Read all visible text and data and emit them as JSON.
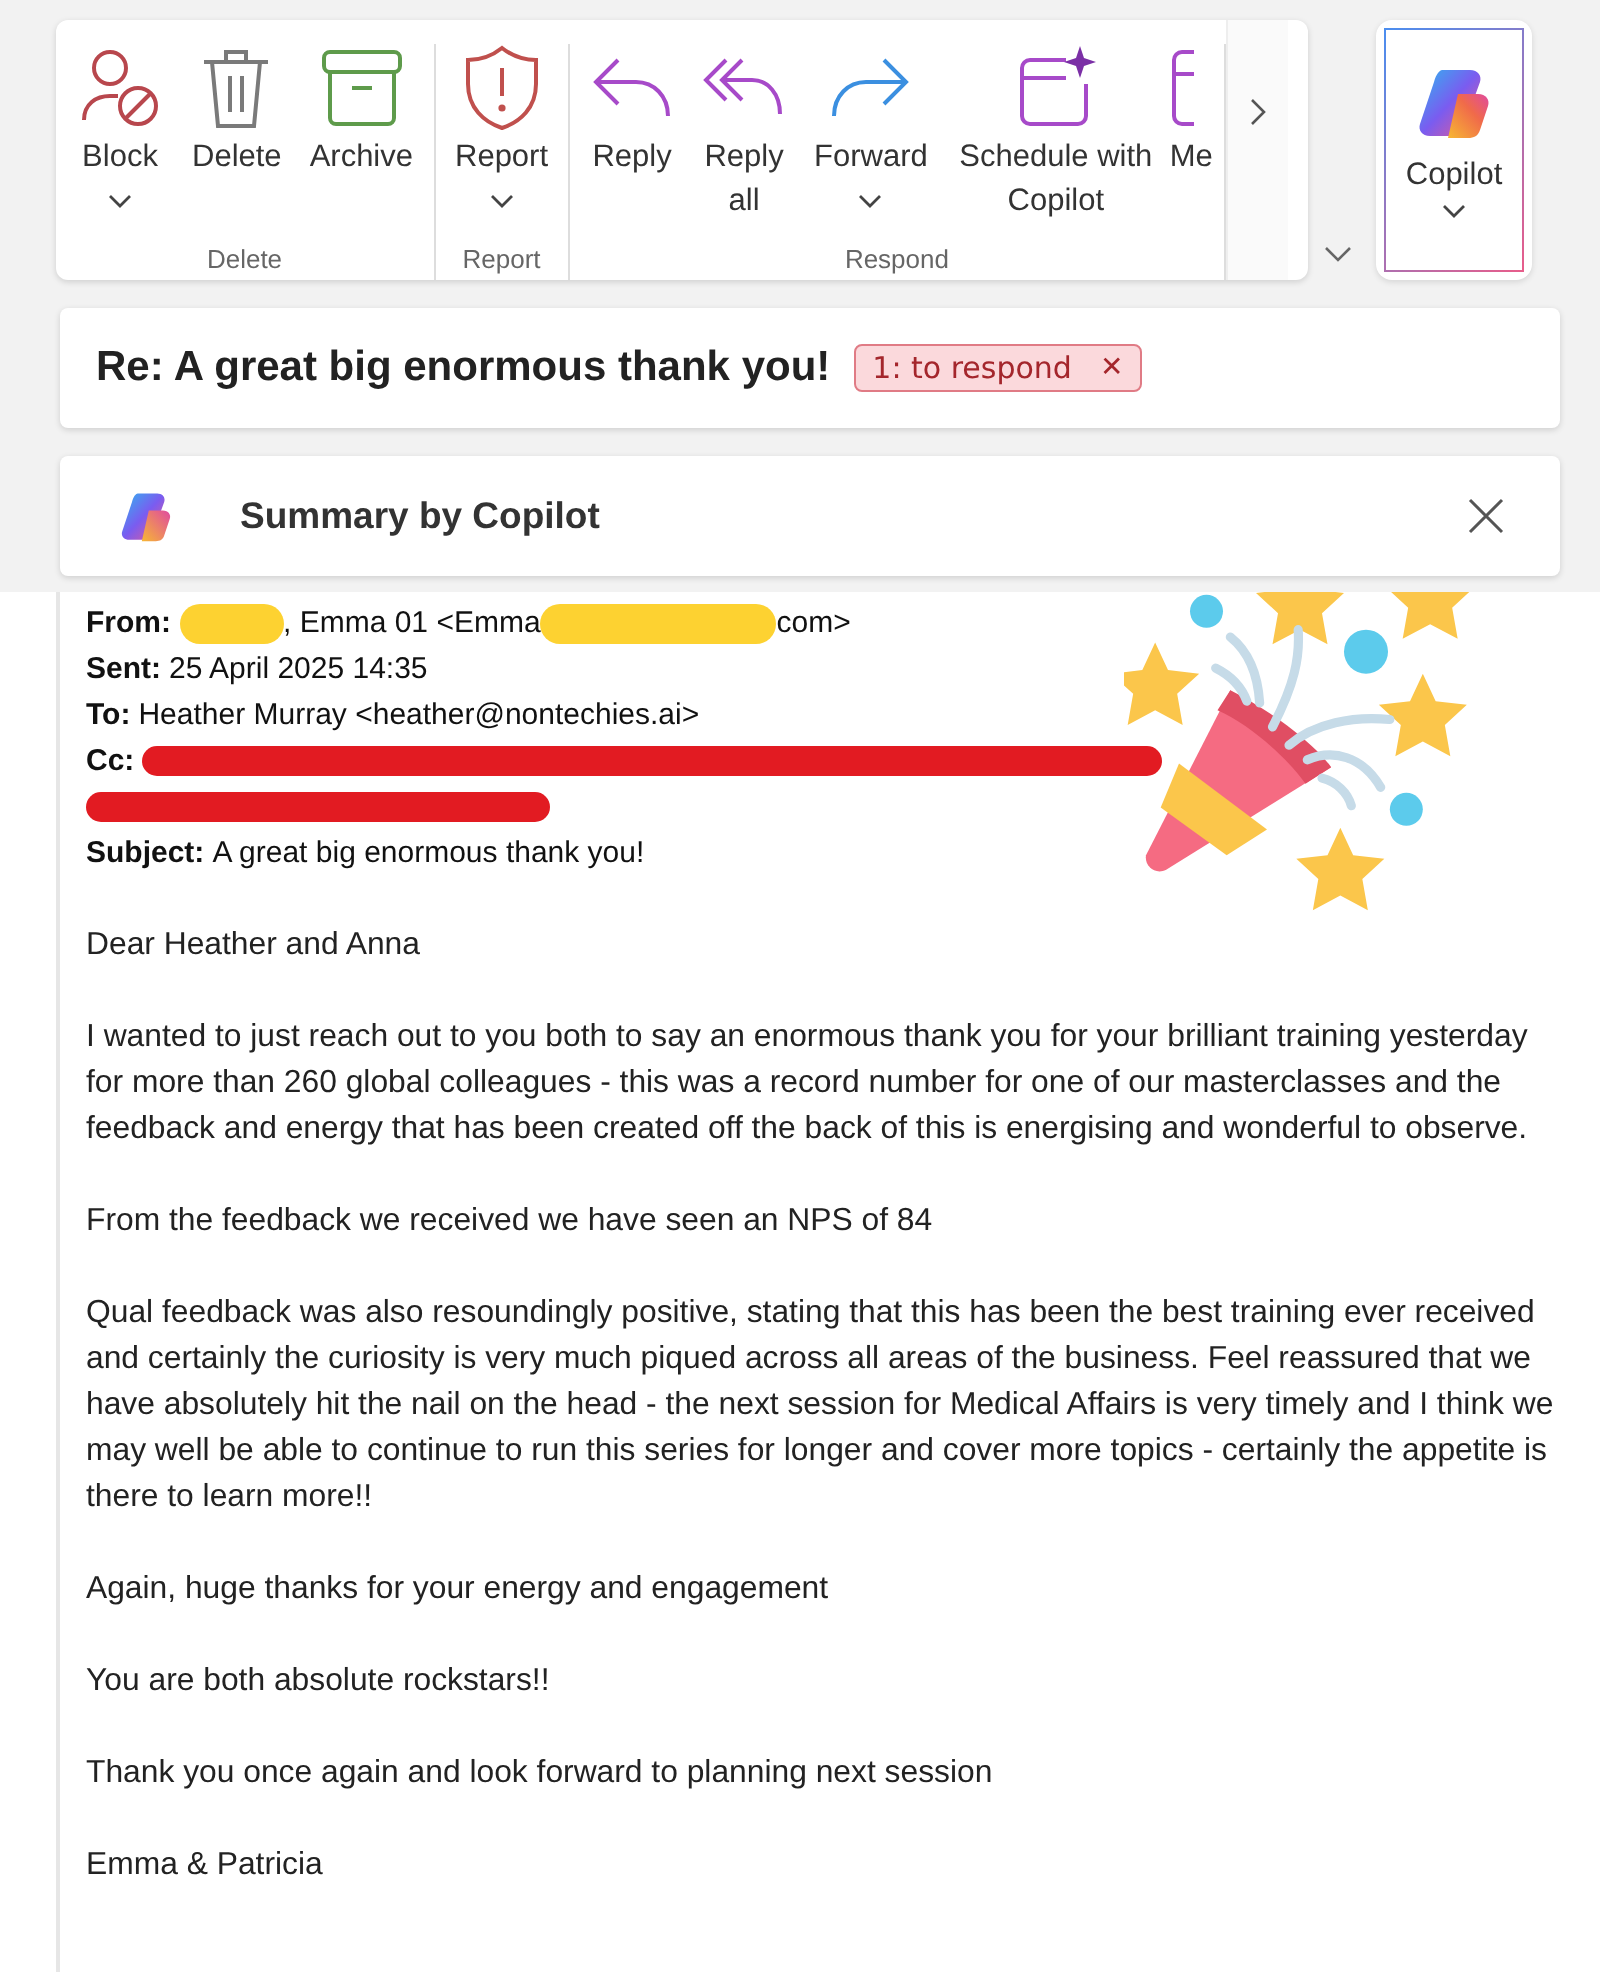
{
  "ribbon": {
    "groups": [
      {
        "label": "Delete",
        "buttons": [
          {
            "label": "Block",
            "kind": "block",
            "dropdown": true
          },
          {
            "label": "Delete",
            "kind": "trash",
            "dropdown": false
          },
          {
            "label": "Archive",
            "kind": "archive",
            "dropdown": false
          }
        ]
      },
      {
        "label": "Report",
        "buttons": [
          {
            "label": "Report",
            "kind": "shield",
            "dropdown": true
          }
        ]
      },
      {
        "label": "Respond",
        "buttons": [
          {
            "label": "Reply",
            "kind": "reply",
            "dropdown": false
          },
          {
            "label": "Reply all",
            "kind": "replyall",
            "dropdown": false
          },
          {
            "label": "Forward",
            "kind": "forward",
            "dropdown": true
          },
          {
            "label": "Schedule with Copilot",
            "kind": "schedule",
            "dropdown": false
          },
          {
            "label": "Me",
            "kind": "cut",
            "dropdown": false
          }
        ]
      }
    ],
    "copilot": {
      "label": "Copilot",
      "dropdown": true
    }
  },
  "subject": {
    "title": "Re: A great big enormous thank you!",
    "tag": {
      "label": "1: to respond",
      "close": "✕"
    }
  },
  "summary": {
    "label": "Summary by Copilot"
  },
  "message": {
    "header": [
      {
        "label": "From:",
        "parts": [
          {
            "kind": "redacted",
            "color": "#fdd231"
          },
          {
            "kind": "text",
            "text": ", Emma 01 <Emma"
          },
          {
            "kind": "redacted",
            "color": "#fdd231"
          },
          {
            "kind": "text",
            "text": "com>"
          }
        ]
      },
      {
        "label": "Sent:",
        "parts": [
          {
            "kind": "text",
            "text": "25 April 2025 14:35"
          }
        ]
      },
      {
        "label": "To:",
        "parts": [
          {
            "kind": "text",
            "text": "Heather Murray <heather@nontechies.ai>"
          }
        ]
      },
      {
        "label": "Cc:",
        "parts": [
          {
            "kind": "redacted",
            "color": "#e21b22"
          }
        ]
      },
      {
        "parts": [
          {
            "kind": "redacted",
            "color": "#e21b22"
          }
        ]
      },
      {
        "label": "Subject:",
        "parts": [
          {
            "kind": "text",
            "text": "A great big enormous thank you!"
          }
        ]
      }
    ],
    "paragraphs": [
      "Dear Heather and Anna",
      "I wanted to just reach out to you both to say an enormous thank you for your brilliant training yesterday for more than 260 global colleagues - this was a record number for one of our masterclasses and the feedback and energy that has been created off the back of this is energising and wonderful to observe.",
      "From the feedback we received we have seen an NPS of 84",
      "Qual feedback was also resoundingly positive, stating that this has been the best training ever received and certainly the curiosity is very much piqued across all areas of the business.  Feel reassured that we have absolutely hit the nail on the head - the next session for Medical Affairs is very timely and I think we may well be able to continue to run this series for longer and cover more topics - certainly the appetite is there to learn more!!",
      "Again, huge thanks for your energy and engagement",
      "You are both absolute rockstars!!",
      "Thank you once again and look forward to planning next session",
      "Emma & Patricia"
    ]
  }
}
